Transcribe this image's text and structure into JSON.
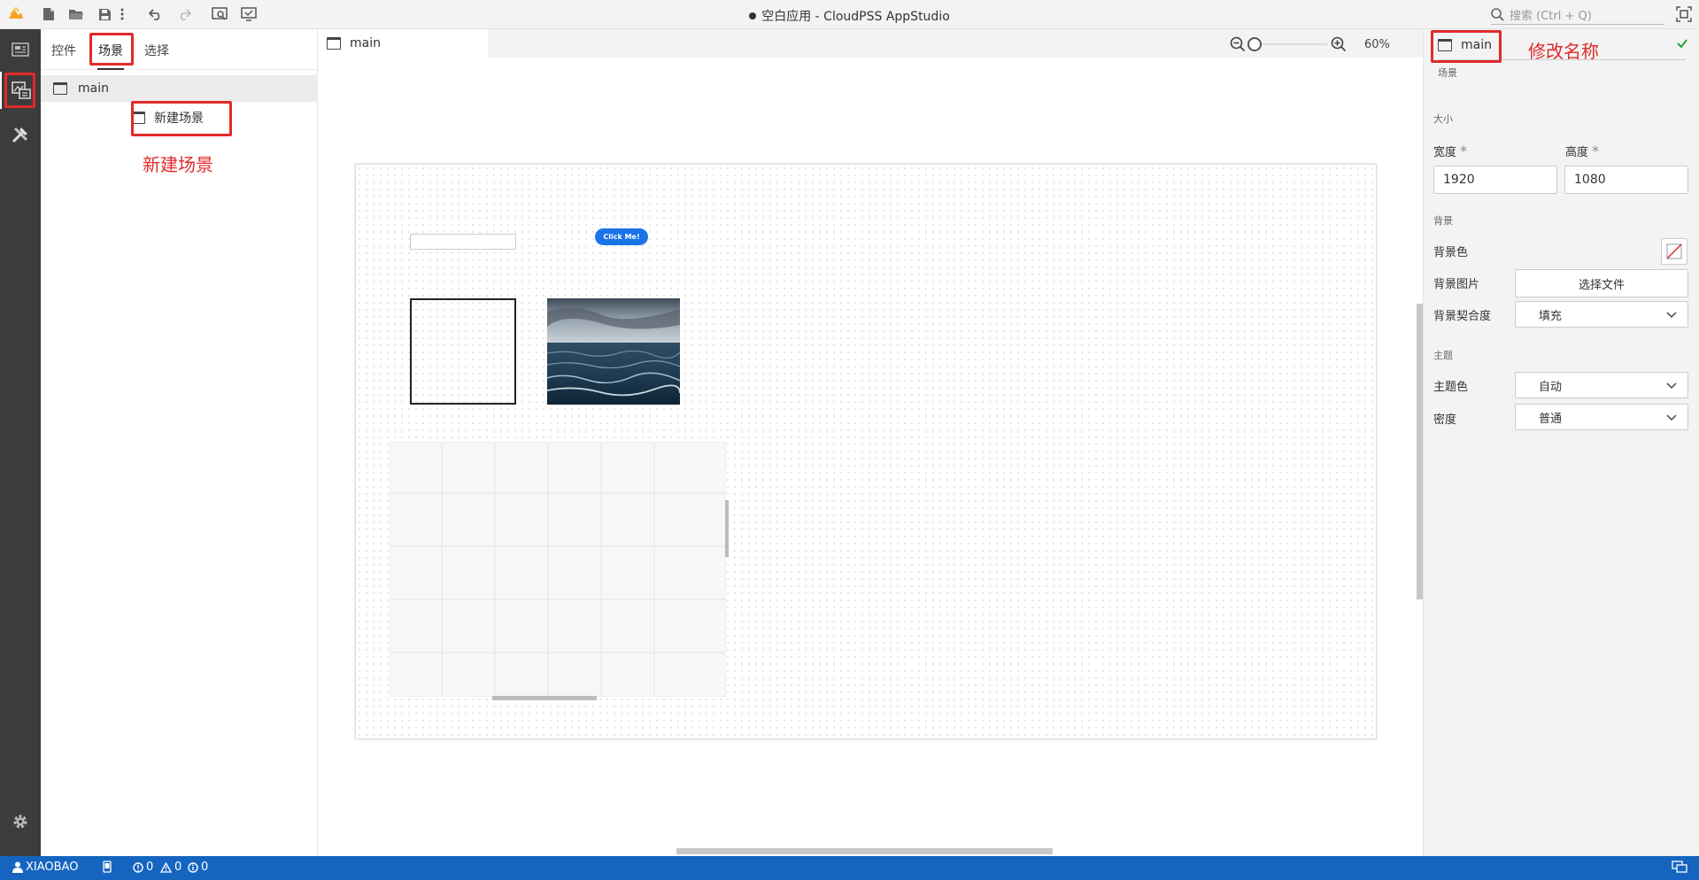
{
  "window": {
    "title": "空白应用 - CloudPSS AppStudio",
    "search_placeholder": "搜索 (Ctrl + Q)"
  },
  "toolbar_icons": [
    "app-logo-icon",
    "new-file-icon",
    "open-folder-icon",
    "save-icon",
    "more-icon",
    "undo-icon",
    "redo-icon",
    "preview-icon",
    "publish-icon"
  ],
  "left_panel": {
    "tabs": [
      {
        "label": "控件"
      },
      {
        "label": "场景"
      },
      {
        "label": "选择"
      }
    ],
    "active_tab": "场景",
    "scenes": [
      {
        "label": "main"
      }
    ],
    "new_scene_label": "新建场景"
  },
  "annotations": {
    "new_scene": "新建场景",
    "rename": "修改名称"
  },
  "editor": {
    "tab_label": "main",
    "zoom_label": "60%",
    "zoom_percent": 60,
    "canvas_button_label": "Click Me!"
  },
  "properties": {
    "name_value": "main",
    "type_label": "场景",
    "size_section": "大小",
    "width_label": "宽度",
    "width_value": "1920",
    "height_label": "高度",
    "height_value": "1080",
    "required_mark": "*",
    "bg_section": "背景",
    "bg_color_label": "背景色",
    "bg_image_label": "背景图片",
    "choose_file_label": "选择文件",
    "bg_fit_label": "背景契合度",
    "bg_fit_value": "填充",
    "theme_section": "主题",
    "theme_color_label": "主题色",
    "theme_color_value": "自动",
    "density_label": "密度",
    "density_value": "普通"
  },
  "status_bar": {
    "user": "XIAOBAO",
    "errors": "0",
    "warnings": "0",
    "infos": "0"
  },
  "colors": {
    "accent": "#1565c0",
    "annotation": "#e02a2a",
    "activity_bar": "#3c3c3c",
    "button": "#1a73e8"
  }
}
